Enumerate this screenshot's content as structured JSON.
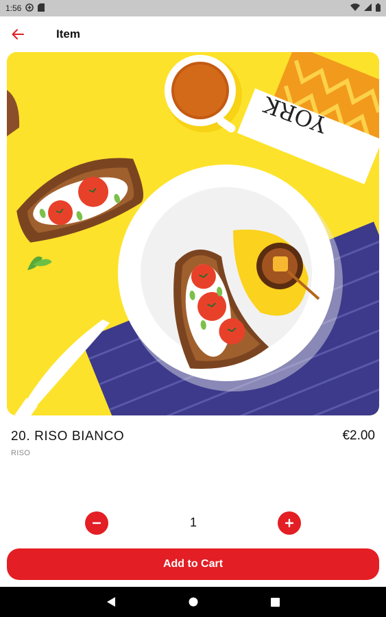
{
  "status_bar": {
    "time": "1:56"
  },
  "app_bar": {
    "title": "Item"
  },
  "item": {
    "name": "20. RISO BIANCO",
    "category": "RISO",
    "price": "€2.00",
    "quantity": "1"
  },
  "hero_image": {
    "magazine_text": "YORK"
  },
  "actions": {
    "add_to_cart": "Add to Cart"
  },
  "colors": {
    "accent": "#e31e24",
    "hero_background": "#fde22b"
  }
}
